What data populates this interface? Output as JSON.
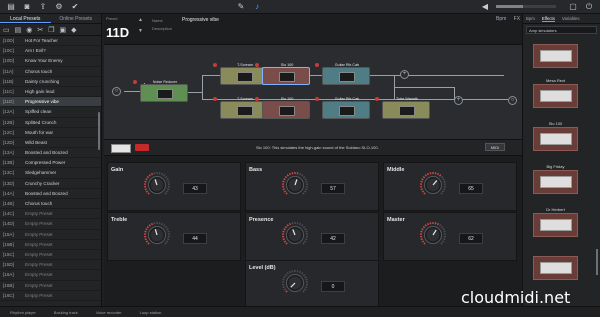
{
  "toolbar": {
    "icons": [
      "folder-icon",
      "save-icon",
      "export-icon",
      "settings-icon",
      "check-icon"
    ],
    "mid_icons": [
      "wrench-icon",
      "tuner-icon"
    ],
    "right_icons": [
      "mute-icon",
      "monitor-icon",
      "power-icon"
    ],
    "volume": 0.45
  },
  "left": {
    "tabs": [
      "Local Presets",
      "Online Presets"
    ],
    "tool_icons": [
      "new-icon",
      "folder-icon",
      "lock-icon",
      "cut-icon",
      "copy-icon",
      "paste-icon",
      "tag-icon"
    ],
    "presets": [
      {
        "num": "[10D]",
        "name": "Hot For Teacher"
      },
      {
        "num": "[10C]",
        "name": "Am I Evil?"
      },
      {
        "num": "[10D]",
        "name": "Know Your Enemy"
      },
      {
        "num": "[11A]",
        "name": "Chorus touch"
      },
      {
        "num": "[11B]",
        "name": "Dainty crunching"
      },
      {
        "num": "[11C]",
        "name": "High gain lead"
      },
      {
        "num": "[11D]",
        "name": "Progressive vibe",
        "selected": true
      },
      {
        "num": "[12A]",
        "name": "Spiffed clean"
      },
      {
        "num": "[12B]",
        "name": "Splitted Crunch"
      },
      {
        "num": "[12C]",
        "name": "Mouth for war"
      },
      {
        "num": "[12D]",
        "name": "Wild Beast"
      },
      {
        "num": "[13A]",
        "name": "Boosted and Boozed"
      },
      {
        "num": "[13B]",
        "name": "Compressed Power"
      },
      {
        "num": "[13C]",
        "name": "Sledgehammer"
      },
      {
        "num": "[13D]",
        "name": "Crunchy Cracker"
      },
      {
        "num": "[14A]",
        "name": "Boosted and Boozed"
      },
      {
        "num": "[14B]",
        "name": "Chorus touch"
      },
      {
        "num": "[14C]",
        "name": "Empty Preset",
        "empty": true
      },
      {
        "num": "[14D]",
        "name": "Empty Preset",
        "empty": true
      },
      {
        "num": "[15A]",
        "name": "Empty Preset",
        "empty": true
      },
      {
        "num": "[15B]",
        "name": "Empty Preset",
        "empty": true
      },
      {
        "num": "[15C]",
        "name": "Empty Preset",
        "empty": true
      },
      {
        "num": "[15D]",
        "name": "Empty Preset",
        "empty": true
      },
      {
        "num": "[16A]",
        "name": "Empty Preset",
        "empty": true
      },
      {
        "num": "[16B]",
        "name": "Empty Preset",
        "empty": true
      },
      {
        "num": "[16C]",
        "name": "Empty Preset",
        "empty": true
      }
    ]
  },
  "header": {
    "preset_label": "Preset",
    "preset_number": "11D",
    "name_label": "Name",
    "name_value": "Progressive vibe",
    "desc_label": "Description",
    "side_labels": [
      "Bpm",
      "FX"
    ]
  },
  "chain": {
    "blocks": [
      {
        "label": "Noise Reducer",
        "color": "#5f8f53"
      },
      {
        "label": "T-Scream",
        "color": "#8a8b5a"
      },
      {
        "label": "Slo 100",
        "color": "#7a4d4a"
      },
      {
        "label": "Guitar Rfx Cab",
        "color": "#4f7d86"
      },
      {
        "label": "T-Scream",
        "color": "#8a8b5a"
      },
      {
        "label": "Slo 100",
        "color": "#7a4d4a"
      },
      {
        "label": "Guitar Rfx Cab",
        "color": "#4f7d86"
      },
      {
        "label": "Tube Warmth",
        "color": "#8a8b5a"
      }
    ]
  },
  "info": {
    "text": "Slo 100: This simulates the high-gain sound of the Soldano SLO-100.",
    "midi": "MIDI"
  },
  "knobs": [
    {
      "label": "Gain",
      "value": "43"
    },
    {
      "label": "Bass",
      "value": "57"
    },
    {
      "label": "Middle",
      "value": "65"
    },
    {
      "label": "Treble",
      "value": "44"
    },
    {
      "label": "Presence",
      "value": "42"
    },
    {
      "label": "Master",
      "value": "62"
    },
    {
      "label": "Level (dB)",
      "value": "0"
    }
  ],
  "right": {
    "tabs": [
      "Effects",
      "Variables"
    ],
    "select": "Amp simulators",
    "amps": [
      "",
      "Mesa Rect",
      "Slo 100",
      "Big Friday",
      "Dr Herbert",
      ""
    ]
  },
  "bottom": {
    "items": [
      "Rhythm player",
      "Backing track",
      "Voice recorder",
      "Loop station"
    ]
  },
  "watermark": "cloudmidi.net"
}
